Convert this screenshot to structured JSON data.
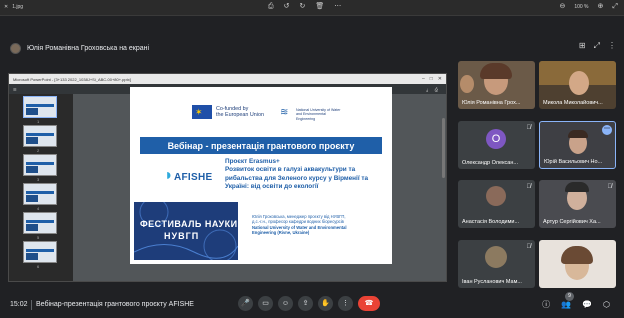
{
  "viewer": {
    "file_name": "1.jpg",
    "zoom": "100 %",
    "icons": [
      "close-icon",
      "save-icon",
      "rotate-left-icon",
      "rotate-right-icon",
      "delete-icon",
      "more-icon",
      "zoom-out-icon",
      "zoom-in-icon",
      "fullscreen-icon"
    ]
  },
  "presenting": {
    "text": "Юлія Романівна Гроховська на екрані"
  },
  "shared_window": {
    "title": "Microsoft PowerPoint - [3+133 2022_1038J+Si_ABC-00+80+.pptx]",
    "page_indicator": "1 / 2",
    "zoom": "100%",
    "thumb_numbers": [
      "1",
      "2",
      "3",
      "4",
      "5",
      "6"
    ]
  },
  "slide": {
    "eu_text_1": "Co-funded by",
    "eu_text_2": "the European Union",
    "nu_text_1": "National University of Water",
    "nu_text_2": "and Environmental",
    "nu_text_3": "Engineering",
    "title": "Вебінар - презентація грантового проєкту",
    "proj_line_1": "Проєкт Erasmus+",
    "proj_line_2": "Розвиток освіти в галузі аквакультури та рибальства для Зеленого курсу у Вірменії та Україні: від освіти до екології",
    "afishe": "AFISHE",
    "festival_1": "ФЕСТИВАЛЬ НАУКИ",
    "festival_2": "НУВГП",
    "author_1": "Юлія Гроховська, менеджер проєкту від НУВГП,",
    "author_2": "д.с.-г.н., професор кафедри водних біоресурсів",
    "author_3": "National University of Water and Environmental",
    "author_4": "Engineering (Rivne, Ukraine)"
  },
  "participants": [
    {
      "name": "Юлія Романівна Грох...",
      "avatar": "video"
    },
    {
      "name": "Микола Миколайович...",
      "avatar": "video"
    },
    {
      "name": "Олександр Олексан...",
      "avatar": "O"
    },
    {
      "name": "Юрій Васильович Но...",
      "avatar": "video"
    },
    {
      "name": "Анастасія Володими...",
      "avatar": "video"
    },
    {
      "name": "Артур Сергійович Ха...",
      "avatar": "video"
    },
    {
      "name": "Іван Русланович Мам...",
      "avatar": "video"
    },
    {
      "name": "",
      "avatar": "video"
    }
  ],
  "bottom": {
    "time": "15:02",
    "meeting_title": "Вебінар-презентація грантового проєкту AFISHE",
    "participants_count": "9"
  }
}
